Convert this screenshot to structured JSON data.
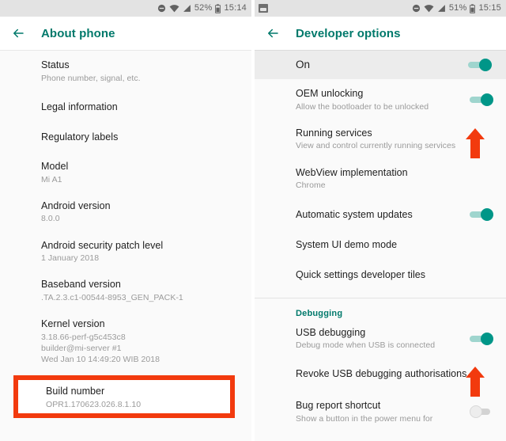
{
  "left_screen": {
    "status_bar": {
      "icons": [
        "do-not-disturb-icon",
        "wifi-icon",
        "signal-icon"
      ],
      "battery_percent": "52%",
      "time": "15:14"
    },
    "appbar": {
      "back_icon": "back-arrow-icon",
      "title": "About phone"
    },
    "items": [
      {
        "title": "Status",
        "sub": [
          "Phone number, signal, etc."
        ]
      },
      {
        "title": "Legal information",
        "sub": []
      },
      {
        "title": "Regulatory labels",
        "sub": []
      },
      {
        "title": "Model",
        "sub": [
          "Mi A1"
        ]
      },
      {
        "title": "Android version",
        "sub": [
          "8.0.0"
        ]
      },
      {
        "title": "Android security patch level",
        "sub": [
          "1 January 2018"
        ]
      },
      {
        "title": "Baseband version",
        "sub": [
          ".TA.2.3.c1-00544-8953_GEN_PACK-1"
        ]
      },
      {
        "title": "Kernel version",
        "sub": [
          "3.18.66-perf-g5c453c8",
          "builder@mi-server #1",
          "Wed Jan 10 14:49:20 WIB 2018"
        ]
      }
    ],
    "highlighted_item": {
      "title": "Build number",
      "sub": [
        "OPR1.170623.026.8.1.10"
      ]
    }
  },
  "right_screen": {
    "status_bar": {
      "icons": [
        "screenshot-icon",
        "do-not-disturb-icon",
        "wifi-icon",
        "signal-icon"
      ],
      "battery_percent": "51%",
      "time": "15:15"
    },
    "appbar": {
      "back_icon": "back-arrow-icon",
      "title": "Developer options"
    },
    "master_toggle": {
      "label": "On",
      "state": "on"
    },
    "items": [
      {
        "title": "OEM unlocking",
        "sub": [
          "Allow the bootloader to be unlocked"
        ],
        "toggle": "on"
      },
      {
        "title": "Running services",
        "sub": [
          "View and control currently running services"
        ],
        "toggle": null
      },
      {
        "title": "WebView implementation",
        "sub": [
          "Chrome"
        ],
        "toggle": null
      },
      {
        "title": "Automatic system updates",
        "sub": [],
        "toggle": "on"
      },
      {
        "title": "System UI demo mode",
        "sub": [],
        "toggle": null
      },
      {
        "title": "Quick settings developer tiles",
        "sub": [],
        "toggle": null
      }
    ],
    "section_header": "Debugging",
    "debug_items": [
      {
        "title": "USB debugging",
        "sub": [
          "Debug mode when USB is connected"
        ],
        "toggle": "on"
      },
      {
        "title": "Revoke USB debugging authorisations",
        "sub": [],
        "toggle": null
      },
      {
        "title": "Bug report shortcut",
        "sub": [
          "Show a button in the power menu for"
        ],
        "toggle": "off"
      }
    ]
  },
  "annotations": {
    "highlight_color": "#f23a0e",
    "arrow_color": "#f23a0e",
    "arrow_1_target": "oem-unlocking-toggle",
    "arrow_2_target": "usb-debugging-toggle"
  },
  "theme": {
    "accent": "#00796b",
    "toggle_on": "#009688",
    "background": "#fafafa"
  }
}
